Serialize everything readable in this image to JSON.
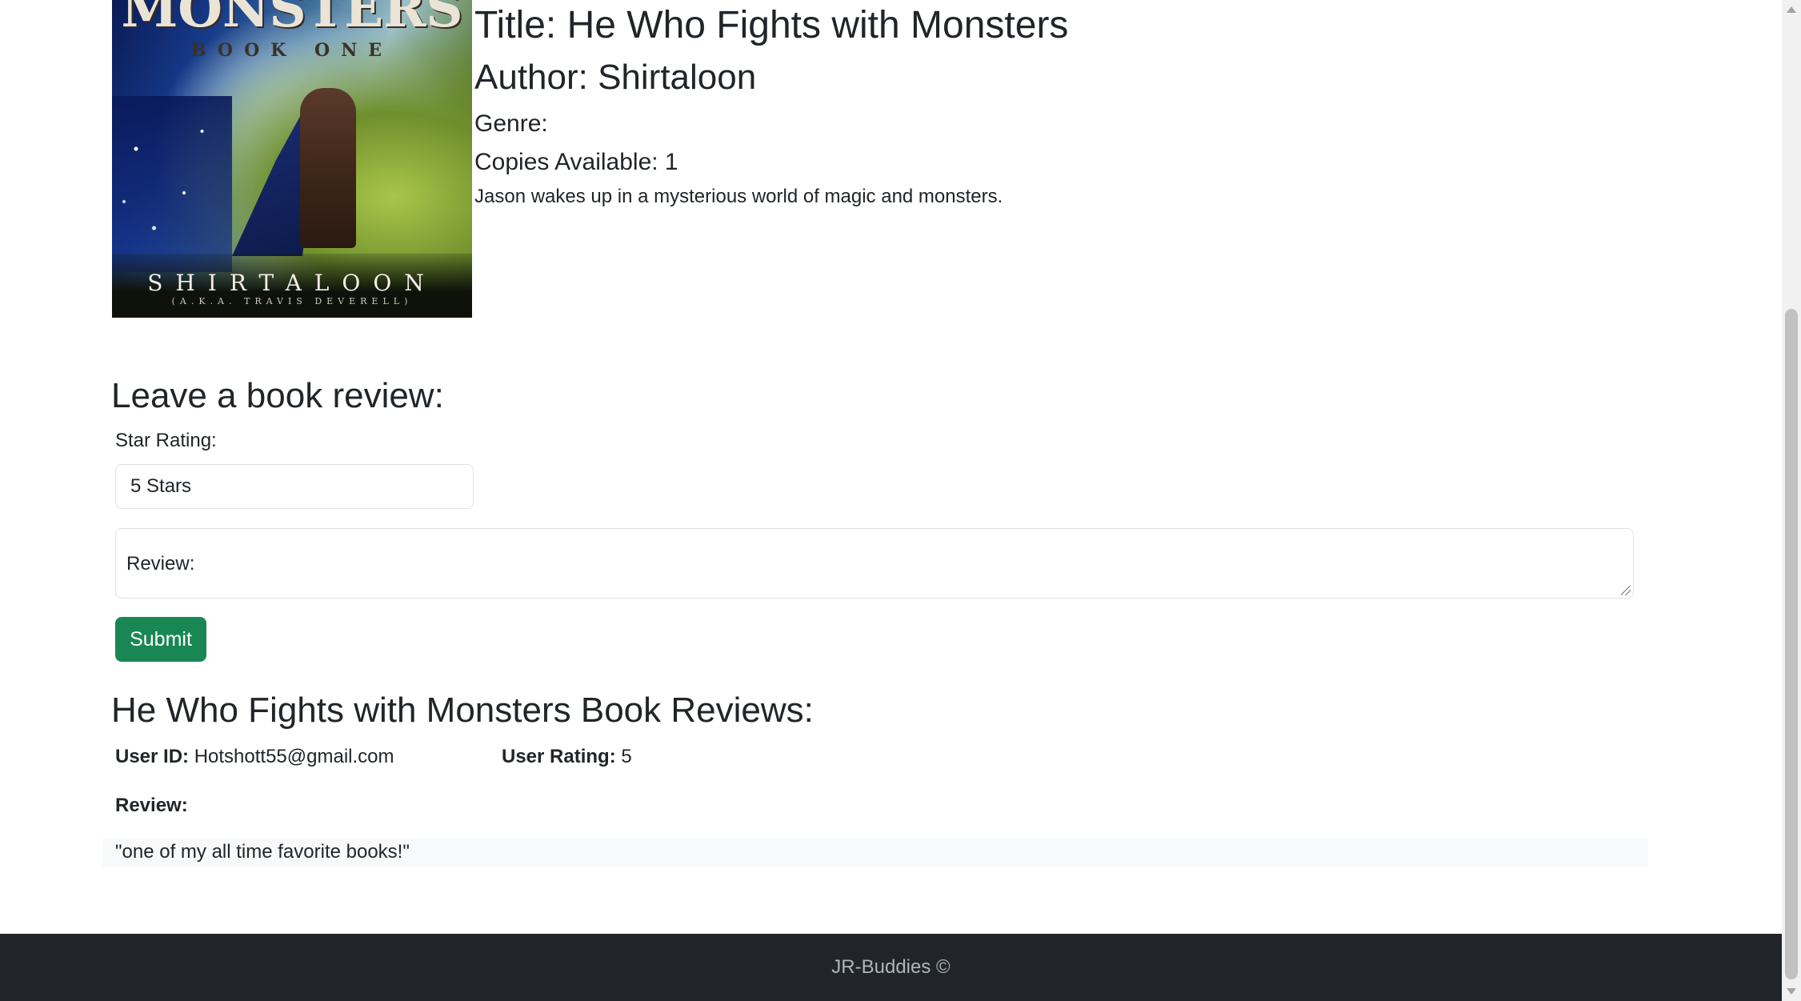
{
  "book": {
    "cover": {
      "series_text": "MONSTERS",
      "book_text": "BOOK ONE",
      "author_text": "SHIRTALOON",
      "aka_text": "(A.K.A. TRAVIS DEVERELL)"
    },
    "title": "Title: He Who Fights with Monsters",
    "author": "Author: Shirtaloon",
    "genre": "Genre:",
    "copies": "Copies Available: 1",
    "description": "Jason wakes up in a mysterious world of magic and monsters."
  },
  "review_form": {
    "heading": "Leave a book review:",
    "star_label": "Star Rating:",
    "star_value": "5 Stars",
    "review_label": "Review:",
    "submit_label": "Submit"
  },
  "reviews": {
    "heading": "He Who Fights with Monsters Book Reviews:",
    "items": [
      {
        "user_id_label": "User ID:",
        "user_id": "Hotshott55@gmail.com",
        "rating_label": "User Rating:",
        "rating": "5",
        "review_label": "Review:",
        "text": "\"one of my all time favorite books!\""
      }
    ]
  },
  "footer": {
    "text": "JR-Buddies ©"
  },
  "colors": {
    "submit": "#198754",
    "footer_bg": "#212529",
    "footer_text": "#adb5bd",
    "text": "#212529"
  }
}
